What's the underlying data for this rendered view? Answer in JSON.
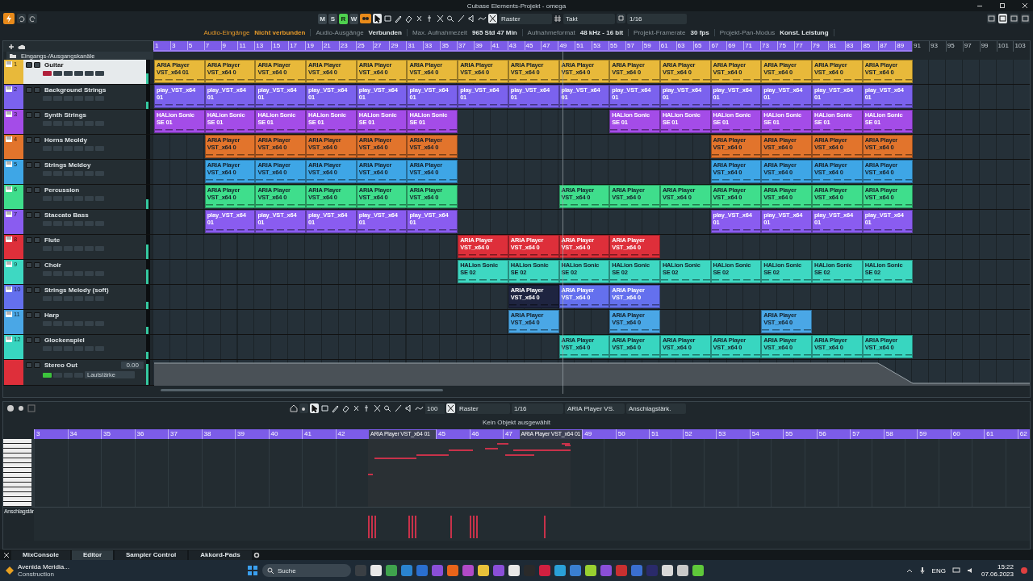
{
  "window": {
    "title": "Cubase Elements-Projekt - omega"
  },
  "toolbar": {
    "mode_buttons": [
      {
        "label": "M",
        "on": false
      },
      {
        "label": "S",
        "on": false
      },
      {
        "label": "R",
        "on": true
      },
      {
        "label": "W",
        "on": false
      }
    ],
    "grid_type": "Raster",
    "ruler_format": "Takt",
    "quantize": "1/16"
  },
  "status_line": [
    {
      "label": "Audio-Eingänge",
      "value": "Nicht verbunden",
      "warning": true
    },
    {
      "label": "Audio-Ausgänge",
      "value": "Verbunden",
      "warning": false
    },
    {
      "label": "Max. Aufnahmezeit",
      "value": "965 Std 47 Min",
      "warning": false
    },
    {
      "label": "Aufnahmeformat",
      "value": "48 kHz - 16 bit",
      "warning": false
    },
    {
      "label": "Projekt-Framerate",
      "value": "30 fps",
      "warning": false
    },
    {
      "label": "Projekt-Pan-Modus",
      "value": "Konst. Leistung",
      "warning": false
    }
  ],
  "track_list": {
    "folder": "Eingangs-/Ausgangskanäle"
  },
  "ruler": {
    "range_marks": [
      "1",
      "3",
      "5",
      "7",
      "9",
      "11",
      "13",
      "15",
      "17",
      "19",
      "21",
      "23",
      "25",
      "27",
      "29",
      "31",
      "33",
      "35",
      "37",
      "39",
      "41",
      "43",
      "45",
      "47",
      "49",
      "51",
      "53",
      "55",
      "57",
      "59",
      "61",
      "63",
      "65",
      "67",
      "69",
      "71",
      "73",
      "75",
      "77",
      "79",
      "81",
      "83",
      "85",
      "87",
      "89"
    ],
    "marks": [
      "91",
      "93",
      "95",
      "97",
      "99",
      "101",
      "103"
    ]
  },
  "tracks": [
    {
      "kind": "instrument",
      "number": "1",
      "name": "Guitar",
      "color": "#e8b93a",
      "selected": true,
      "level": 0.45,
      "slots": [
        {
          "kind": "clip",
          "label": "ARIA Player VST_x64 01",
          "selected": false
        },
        {
          "kind": "clip",
          "label": "ARIA Player VST_x64 0",
          "selected": false
        },
        {
          "kind": "clip",
          "label": "ARIA Player VST_x64 0",
          "selected": false
        },
        {
          "kind": "clip",
          "label": "ARIA Player VST_x64 0",
          "selected": false
        },
        {
          "kind": "clip",
          "label": "ARIA Player VST_x64 0",
          "selected": false
        },
        {
          "kind": "clip",
          "label": "ARIA Player VST_x64 0",
          "selected": false
        },
        {
          "kind": "clip",
          "label": "ARIA Player VST_x64 0",
          "selected": false
        },
        {
          "kind": "clip",
          "label": "ARIA Player VST_x64 0",
          "selected": false
        },
        {
          "kind": "clip",
          "label": "ARIA Player VST_x64 0",
          "selected": false
        },
        {
          "kind": "clip",
          "label": "ARIA Player VST_x64 0",
          "selected": false
        },
        {
          "kind": "clip",
          "label": "ARIA Player VST_x64 0",
          "selected": false
        },
        {
          "kind": "clip",
          "label": "ARIA Player VST_x64 0",
          "selected": false
        },
        {
          "kind": "clip",
          "label": "ARIA Player VST_x64 0",
          "selected": false
        },
        {
          "kind": "clip",
          "label": "ARIA Player VST_x64 0",
          "selected": false
        },
        {
          "kind": "clip",
          "label": "ARIA Player VST_x64 0",
          "selected": false
        }
      ]
    },
    {
      "kind": "instrument",
      "number": "2",
      "name": "Background Strings",
      "color": "#7b62ee",
      "selected": false,
      "level": 0.3,
      "slots": [
        {
          "kind": "clip",
          "label": "play_VST_x64 01",
          "selected": false
        },
        {
          "kind": "clip",
          "label": "play_VST_x64 01",
          "selected": false
        },
        {
          "kind": "clip",
          "label": "play_VST_x64 01",
          "selected": false
        },
        {
          "kind": "clip",
          "label": "play_VST_x64 01",
          "selected": false
        },
        {
          "kind": "clip",
          "label": "play_VST_x64 01",
          "selected": false
        },
        {
          "kind": "clip",
          "label": "play_VST_x64 01",
          "selected": false
        },
        {
          "kind": "clip",
          "label": "play_VST_x64 01",
          "selected": false
        },
        {
          "kind": "clip",
          "label": "play_VST_x64 01",
          "selected": false
        },
        {
          "kind": "clip",
          "label": "play_VST_x64 01",
          "selected": false
        },
        {
          "kind": "clip",
          "label": "play_VST_x64 01",
          "selected": false
        },
        {
          "kind": "clip",
          "label": "play_VST_x64 01",
          "selected": false
        },
        {
          "kind": "clip",
          "label": "play_VST_x64 01",
          "selected": false
        },
        {
          "kind": "clip",
          "label": "play_VST_x64 01",
          "selected": false
        },
        {
          "kind": "clip",
          "label": "play_VST_x64 01",
          "selected": false
        },
        {
          "kind": "clip",
          "label": "play_VST_x64 01",
          "selected": false
        }
      ]
    },
    {
      "kind": "instrument",
      "number": "3",
      "name": "Synth Strings",
      "color": "#a44ce8",
      "selected": false,
      "slots": [
        {
          "kind": "clip",
          "label": "HALion Sonic SE 01",
          "selected": false
        },
        {
          "kind": "clip",
          "label": "HALion Sonic SE 01",
          "selected": false
        },
        {
          "kind": "clip",
          "label": "HALion Sonic SE 01",
          "selected": false
        },
        {
          "kind": "clip",
          "label": "HALion Sonic SE 01",
          "selected": false
        },
        {
          "kind": "clip",
          "label": "HALion Sonic SE 01",
          "selected": false
        },
        {
          "kind": "clip",
          "label": "HALion Sonic SE 01",
          "selected": false
        },
        {
          "kind": "empty"
        },
        {
          "kind": "empty"
        },
        {
          "kind": "empty"
        },
        {
          "kind": "clip",
          "label": "HALion Sonic SE 01",
          "selected": false
        },
        {
          "kind": "clip",
          "label": "HALion Sonic SE 01",
          "selected": false
        },
        {
          "kind": "clip",
          "label": "HALion Sonic SE 01",
          "selected": false
        },
        {
          "kind": "clip",
          "label": "HALion Sonic SE 01",
          "selected": false
        },
        {
          "kind": "clip",
          "label": "HALion Sonic SE 01",
          "selected": false
        },
        {
          "kind": "clip",
          "label": "HALion Sonic SE 01",
          "selected": false
        }
      ]
    },
    {
      "kind": "instrument",
      "number": "4",
      "name": "Horns Meoldy",
      "color": "#e2742c",
      "selected": false,
      "slots": [
        {
          "kind": "empty"
        },
        {
          "kind": "clip",
          "label": "ARIA Player VST_x64 0",
          "selected": false
        },
        {
          "kind": "clip",
          "label": "ARIA Player VST_x64 0",
          "selected": false
        },
        {
          "kind": "clip",
          "label": "ARIA Player VST_x64 0",
          "selected": false
        },
        {
          "kind": "clip",
          "label": "ARIA Player VST_x64 0",
          "selected": false
        },
        {
          "kind": "clip",
          "label": "ARIA Player VST_x64 0",
          "selected": false
        },
        {
          "kind": "empty"
        },
        {
          "kind": "empty"
        },
        {
          "kind": "empty"
        },
        {
          "kind": "empty"
        },
        {
          "kind": "empty"
        },
        {
          "kind": "clip",
          "label": "ARIA Player VST_x64 0",
          "selected": false
        },
        {
          "kind": "clip",
          "label": "ARIA Player VST_x64 0",
          "selected": false
        },
        {
          "kind": "clip",
          "label": "ARIA Player VST_x64 0",
          "selected": false
        },
        {
          "kind": "clip",
          "label": "ARIA Player VST_x64 0",
          "selected": false
        }
      ]
    },
    {
      "kind": "instrument",
      "number": "5",
      "name": "Strings Meldoy",
      "color": "#3ea6e6",
      "selected": false,
      "slots": [
        {
          "kind": "empty"
        },
        {
          "kind": "clip",
          "label": "ARIA Player VST_x64 0",
          "selected": false
        },
        {
          "kind": "clip",
          "label": "ARIA Player VST_x64 0",
          "selected": false
        },
        {
          "kind": "clip",
          "label": "ARIA Player VST_x64 0",
          "selected": false
        },
        {
          "kind": "clip",
          "label": "ARIA Player VST_x64 0",
          "selected": false
        },
        {
          "kind": "clip",
          "label": "ARIA Player VST_x64 0",
          "selected": false
        },
        {
          "kind": "empty"
        },
        {
          "kind": "empty"
        },
        {
          "kind": "empty"
        },
        {
          "kind": "empty"
        },
        {
          "kind": "empty"
        },
        {
          "kind": "clip",
          "label": "ARIA Player VST_x64 0",
          "selected": false
        },
        {
          "kind": "clip",
          "label": "ARIA Player VST_x64 0",
          "selected": false
        },
        {
          "kind": "clip",
          "label": "ARIA Player VST_x64 0",
          "selected": false
        },
        {
          "kind": "clip",
          "label": "ARIA Player VST_x64 0",
          "selected": false
        }
      ]
    },
    {
      "kind": "instrument",
      "number": "6",
      "name": "Percussion",
      "color": "#3fde8c",
      "selected": false,
      "level": 0.4,
      "slots": [
        {
          "kind": "empty"
        },
        {
          "kind": "clip",
          "label": "ARIA Player VST_x64 0",
          "selected": false
        },
        {
          "kind": "clip",
          "label": "ARIA Player VST_x64 0",
          "selected": false
        },
        {
          "kind": "clip",
          "label": "ARIA Player VST_x64 0",
          "selected": false
        },
        {
          "kind": "clip",
          "label": "ARIA Player VST_x64 0",
          "selected": false
        },
        {
          "kind": "clip",
          "label": "ARIA Player VST_x64 0",
          "selected": false
        },
        {
          "kind": "empty"
        },
        {
          "kind": "empty"
        },
        {
          "kind": "clip",
          "label": "ARIA Player VST_x64 0",
          "selected": false
        },
        {
          "kind": "clip",
          "label": "ARIA Player VST_x64 0",
          "selected": false
        },
        {
          "kind": "clip",
          "label": "ARIA Player VST_x64 0",
          "selected": false
        },
        {
          "kind": "clip",
          "label": "ARIA Player VST_x64 0",
          "selected": false
        },
        {
          "kind": "clip",
          "label": "ARIA Player VST_x64 0",
          "selected": false
        },
        {
          "kind": "clip",
          "label": "ARIA Player VST_x64 0",
          "selected": false
        },
        {
          "kind": "clip",
          "label": "ARIA Player VST_x64 0",
          "selected": false
        }
      ]
    },
    {
      "kind": "instrument",
      "number": "7",
      "name": "Staccato Bass",
      "color": "#8a5cf0",
      "selected": false,
      "slots": [
        {
          "kind": "empty"
        },
        {
          "kind": "clip",
          "label": "play_VST_x64 01",
          "selected": false
        },
        {
          "kind": "clip",
          "label": "play_VST_x64 01",
          "selected": false
        },
        {
          "kind": "clip",
          "label": "play_VST_x64 01",
          "selected": false
        },
        {
          "kind": "clip",
          "label": "play_VST_x64 01",
          "selected": false
        },
        {
          "kind": "clip",
          "label": "play_VST_x64 01",
          "selected": false
        },
        {
          "kind": "empty"
        },
        {
          "kind": "empty"
        },
        {
          "kind": "empty"
        },
        {
          "kind": "empty"
        },
        {
          "kind": "empty"
        },
        {
          "kind": "clip",
          "label": "play_VST_x64 01",
          "selected": false
        },
        {
          "kind": "clip",
          "label": "play_VST_x64 01",
          "selected": false
        },
        {
          "kind": "clip",
          "label": "play_VST_x64 01",
          "selected": false
        },
        {
          "kind": "clip",
          "label": "play_VST_x64 01",
          "selected": false
        }
      ]
    },
    {
      "kind": "instrument",
      "number": "8",
      "name": "Flute",
      "color": "#de2f3a",
      "selected": false,
      "level": 0.6,
      "slots": [
        {
          "kind": "empty"
        },
        {
          "kind": "empty"
        },
        {
          "kind": "empty"
        },
        {
          "kind": "empty"
        },
        {
          "kind": "empty"
        },
        {
          "kind": "empty"
        },
        {
          "kind": "clip",
          "label": "ARIA Player VST_x64 0",
          "selected": false
        },
        {
          "kind": "clip",
          "label": "ARIA Player VST_x64 0",
          "selected": false
        },
        {
          "kind": "clip",
          "label": "ARIA Player VST_x64 0",
          "selected": false
        },
        {
          "kind": "clip",
          "label": "ARIA Player VST_x64 0",
          "selected": false
        }
      ]
    },
    {
      "kind": "instrument",
      "number": "9",
      "name": "Choir",
      "color": "#3ed8c2",
      "selected": false,
      "level": 0.6,
      "slots": [
        {
          "kind": "empty"
        },
        {
          "kind": "empty"
        },
        {
          "kind": "empty"
        },
        {
          "kind": "empty"
        },
        {
          "kind": "empty"
        },
        {
          "kind": "empty"
        },
        {
          "kind": "clip",
          "label": "HALion Sonic SE 02",
          "selected": false
        },
        {
          "kind": "clip",
          "label": "HALion Sonic SE 02",
          "selected": false
        },
        {
          "kind": "clip",
          "label": "HALion Sonic SE 02",
          "selected": false
        },
        {
          "kind": "clip",
          "label": "HALion Sonic SE 02",
          "selected": false
        },
        {
          "kind": "clip",
          "label": "HALion Sonic SE 02",
          "selected": false
        },
        {
          "kind": "clip",
          "label": "HALion Sonic SE 02",
          "selected": false
        },
        {
          "kind": "clip",
          "label": "HALion Sonic SE 02",
          "selected": false
        },
        {
          "kind": "clip",
          "label": "HALion Sonic SE 02",
          "selected": false
        },
        {
          "kind": "clip",
          "label": "HALion Sonic SE 02",
          "selected": false
        }
      ]
    },
    {
      "kind": "instrument",
      "number": "10",
      "name": "Strings Melody (soft)",
      "color": "#6470ee",
      "selected": false,
      "level": 0.3,
      "slots": [
        {
          "kind": "empty"
        },
        {
          "kind": "empty"
        },
        {
          "kind": "empty"
        },
        {
          "kind": "empty"
        },
        {
          "kind": "empty"
        },
        {
          "kind": "empty"
        },
        {
          "kind": "empty"
        },
        {
          "kind": "clip",
          "label": "ARIA Player VST_x64 0",
          "selected": true
        },
        {
          "kind": "clip",
          "label": "ARIA Player VST_x64 0",
          "selected": false
        },
        {
          "kind": "clip",
          "label": "ARIA Player VST_x64 0",
          "selected": false
        }
      ]
    },
    {
      "kind": "instrument",
      "number": "11",
      "name": "Harp",
      "color": "#4aa7e6",
      "selected": false,
      "level": 0.3,
      "slots": [
        {
          "kind": "empty"
        },
        {
          "kind": "empty"
        },
        {
          "kind": "empty"
        },
        {
          "kind": "empty"
        },
        {
          "kind": "empty"
        },
        {
          "kind": "empty"
        },
        {
          "kind": "empty"
        },
        {
          "kind": "clip",
          "label": "ARIA Player VST_x64 0",
          "selected": false
        },
        {
          "kind": "empty"
        },
        {
          "kind": "clip",
          "label": "ARIA Player VST_x64 0",
          "selected": false
        },
        {
          "kind": "empty"
        },
        {
          "kind": "empty"
        },
        {
          "kind": "clip",
          "label": "ARIA Player VST_x64 0",
          "selected": false
        }
      ]
    },
    {
      "kind": "instrument",
      "number": "12",
      "name": "Glockenspiel",
      "color": "#38d6c0",
      "selected": false,
      "level": 0.3,
      "slots": [
        {
          "kind": "empty"
        },
        {
          "kind": "empty"
        },
        {
          "kind": "empty"
        },
        {
          "kind": "empty"
        },
        {
          "kind": "empty"
        },
        {
          "kind": "empty"
        },
        {
          "kind": "empty"
        },
        {
          "kind": "empty"
        },
        {
          "kind": "clip",
          "label": "ARIA Player VST_x64 0",
          "selected": false
        },
        {
          "kind": "clip",
          "label": "ARIA Player VST_x64 0",
          "selected": false
        },
        {
          "kind": "clip",
          "label": "ARIA Player VST_x64 0",
          "selected": false
        },
        {
          "kind": "clip",
          "label": "ARIA Player VST_x64 0",
          "selected": false
        },
        {
          "kind": "clip",
          "label": "ARIA Player VST_x64 0",
          "selected": false
        },
        {
          "kind": "clip",
          "label": "ARIA Player VST_x64 0",
          "selected": false
        },
        {
          "kind": "clip",
          "label": "ARIA Player VST_x64 0",
          "selected": false
        }
      ]
    },
    {
      "kind": "output",
      "name": "Stereo Out",
      "color": "#de2f3a",
      "selected": false,
      "level": 0.85,
      "value": "0.00",
      "parameter": "Lautstärke"
    }
  ],
  "editor": {
    "zoom": "100",
    "grid_type": "Raster",
    "quantize": "1/16",
    "instrument": "ARIA Player VS.",
    "lane": "Anschlagstärk.",
    "status": "Kein Objekt ausgewählt",
    "velocity_label": "Anschlagstär",
    "ruler": [
      {
        "kind": "mark",
        "label": "3"
      },
      {
        "kind": "mark",
        "label": "34"
      },
      {
        "kind": "mark",
        "label": "35"
      },
      {
        "kind": "mark",
        "label": "36"
      },
      {
        "kind": "mark",
        "label": "37"
      },
      {
        "kind": "mark",
        "label": "38"
      },
      {
        "kind": "mark",
        "label": "39"
      },
      {
        "kind": "mark",
        "label": "40"
      },
      {
        "kind": "mark",
        "label": "41"
      },
      {
        "kind": "mark",
        "label": "42"
      },
      {
        "kind": "part",
        "label": "ARIA Player VST_x64 01"
      },
      {
        "kind": "mark",
        "label": "45"
      },
      {
        "kind": "mark",
        "label": "46"
      },
      {
        "kind": "mark",
        "label": "47"
      },
      {
        "kind": "part",
        "label": "ARIA Player VST_x64 01"
      },
      {
        "kind": "mark",
        "label": "49"
      },
      {
        "kind": "mark",
        "label": "50"
      },
      {
        "kind": "mark",
        "label": "51"
      },
      {
        "kind": "mark",
        "label": "52"
      },
      {
        "kind": "mark",
        "label": "53"
      },
      {
        "kind": "mark",
        "label": "54"
      },
      {
        "kind": "mark",
        "label": "55"
      },
      {
        "kind": "mark",
        "label": "56"
      },
      {
        "kind": "mark",
        "label": "57"
      },
      {
        "kind": "mark",
        "label": "58"
      },
      {
        "kind": "mark",
        "label": "59"
      },
      {
        "kind": "mark",
        "label": "60"
      },
      {
        "kind": "mark",
        "label": "61"
      },
      {
        "kind": "mark",
        "label": "62"
      }
    ]
  },
  "bottom_tabs": [
    {
      "label": "MixConsole",
      "selected": false
    },
    {
      "label": "Editor",
      "selected": true
    },
    {
      "label": "Sampler Control",
      "selected": false
    },
    {
      "label": "Akkord-Pads",
      "selected": false
    }
  ],
  "taskbar": {
    "weather_title": "Avenida Meridia...",
    "weather_subtitle": "Construction",
    "search": "Suche",
    "language": "ENG",
    "time": "15:22",
    "date": "07.06.2023"
  }
}
